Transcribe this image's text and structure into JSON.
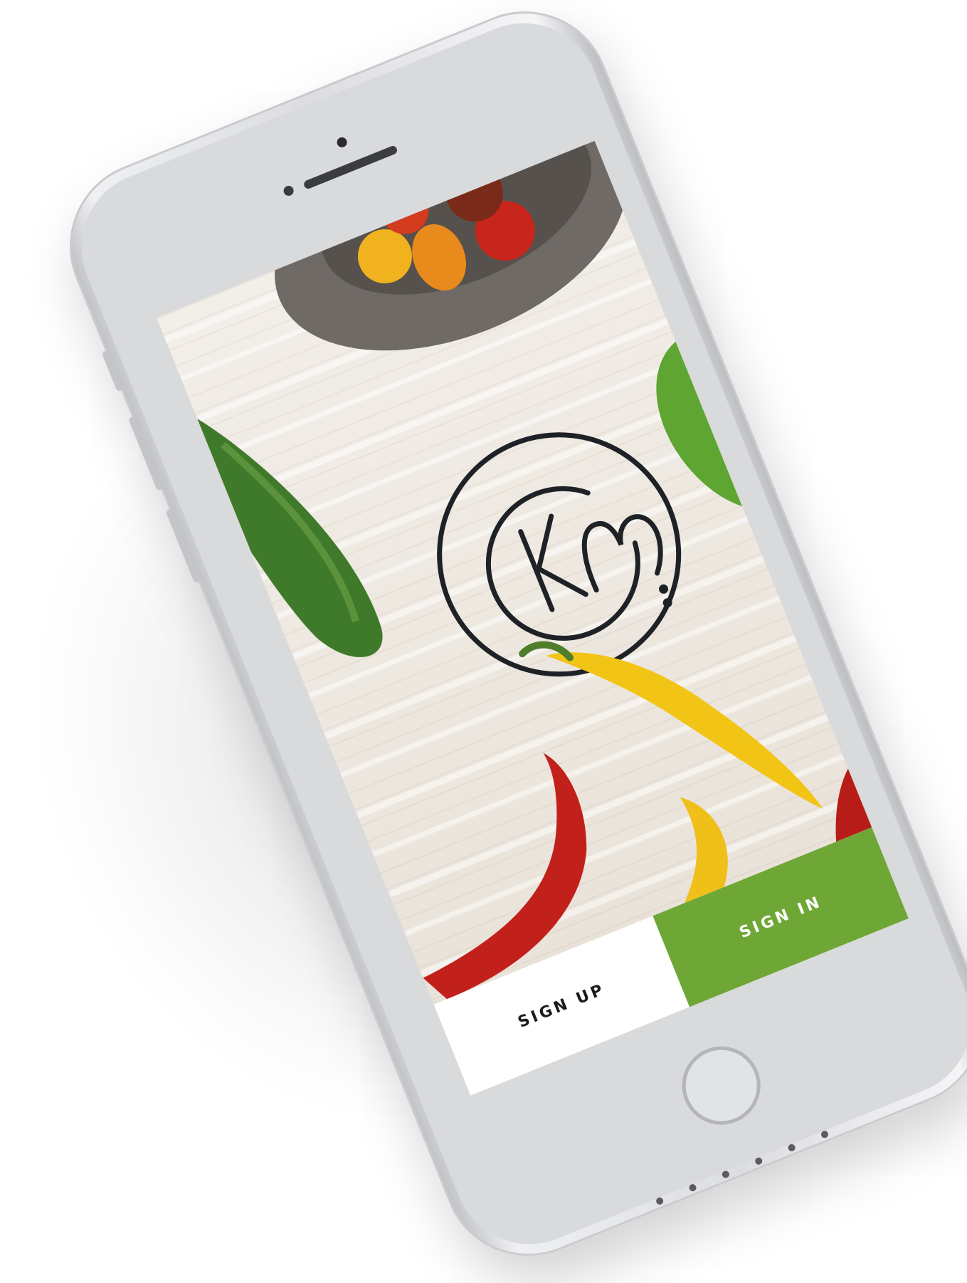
{
  "app": {
    "cta": {
      "sign_up_label": "SIGN UP",
      "sign_in_label": "SIGN IN"
    }
  },
  "colors": {
    "brand_green": "#6ea735",
    "logo_ink": "#1e2226",
    "phone_silver": "#d9dadc"
  },
  "icons": {
    "logo": "km-heart-logo-icon",
    "home": "home-button-icon"
  }
}
